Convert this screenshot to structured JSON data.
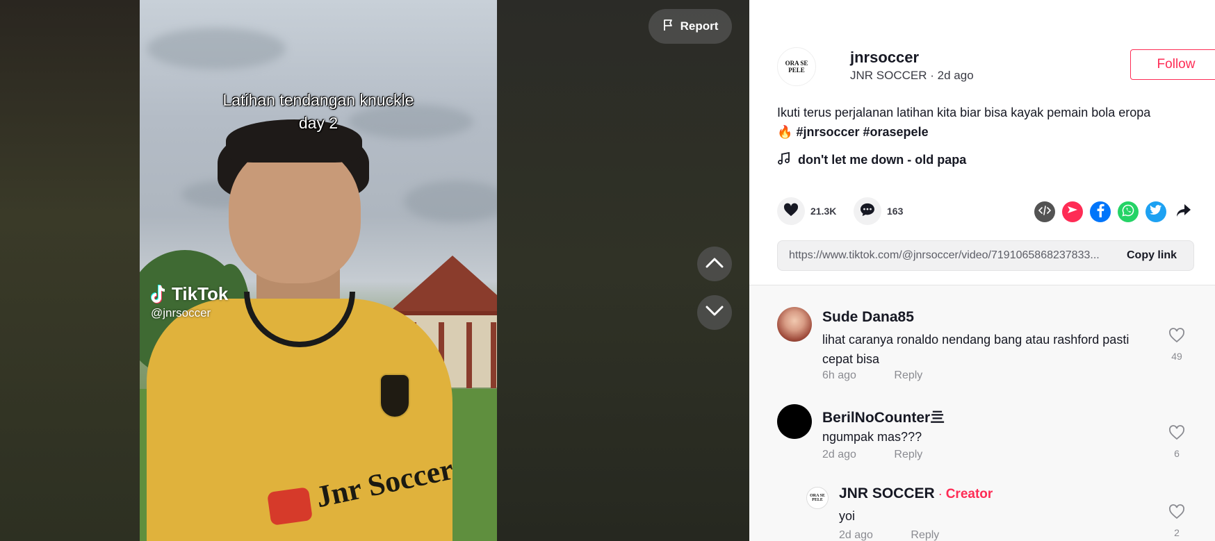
{
  "video": {
    "caption_line1": "Latihan tendangan knuckle",
    "caption_line2": "day 2",
    "watermark_logo": "TikTok",
    "watermark_handle": "@jnrsoccer",
    "sponsor_text": "Jnr Soccer",
    "report_label": "Report"
  },
  "author": {
    "avatar_text_1": "ORA SE",
    "avatar_text_2": "PELE",
    "username": "jnrsoccer",
    "display_name": "JNR SOCCER",
    "separator": "·",
    "posted": "2d ago",
    "follow_label": "Follow"
  },
  "post": {
    "description": "Ikuti terus perjalanan latihan kita biar bisa kayak pemain bola eropa",
    "emoji": "🔥",
    "hashtags": [
      "#jnrsoccer",
      "#orasepele"
    ],
    "music": "don't let me down - old papa",
    "likes": "21.3K",
    "comments": "163",
    "link": "https://www.tiktok.com/@jnrsoccer/video/7191065868237833...",
    "copy_label": "Copy link"
  },
  "comments": [
    {
      "name": "Sude Dana85",
      "text": "lihat caranya ronaldo nendang bang atau rashford pasti cepat bisa",
      "time": "6h ago",
      "reply": "Reply",
      "likes": "49"
    },
    {
      "name": "BerilNoCounter亖",
      "text": "ngumpak mas???",
      "time": "2d ago",
      "reply": "Reply",
      "likes": "6"
    },
    {
      "name": "JNR SOCCER",
      "creator_sep": " · ",
      "creator_tag": "Creator",
      "text": "yoi",
      "time": "2d ago",
      "reply": "Reply",
      "likes": "2"
    }
  ],
  "colors": {
    "accent": "#fe2c55",
    "text": "#161823",
    "muted": "#8a8b91",
    "facebook": "#0075fa",
    "whatsapp": "#25d366",
    "twitter": "#1da1f2",
    "embed": "#535353"
  },
  "icons": {
    "report": "flag-icon",
    "up": "chevron-up-icon",
    "down": "chevron-down-icon",
    "music": "music-note-icon",
    "like": "heart-icon",
    "comment": "comment-bubble-icon",
    "embed": "embed-code-icon",
    "send": "send-to-friends-icon",
    "facebook": "facebook-icon",
    "whatsapp": "whatsapp-icon",
    "twitter": "twitter-icon",
    "share": "share-arrow-icon"
  }
}
